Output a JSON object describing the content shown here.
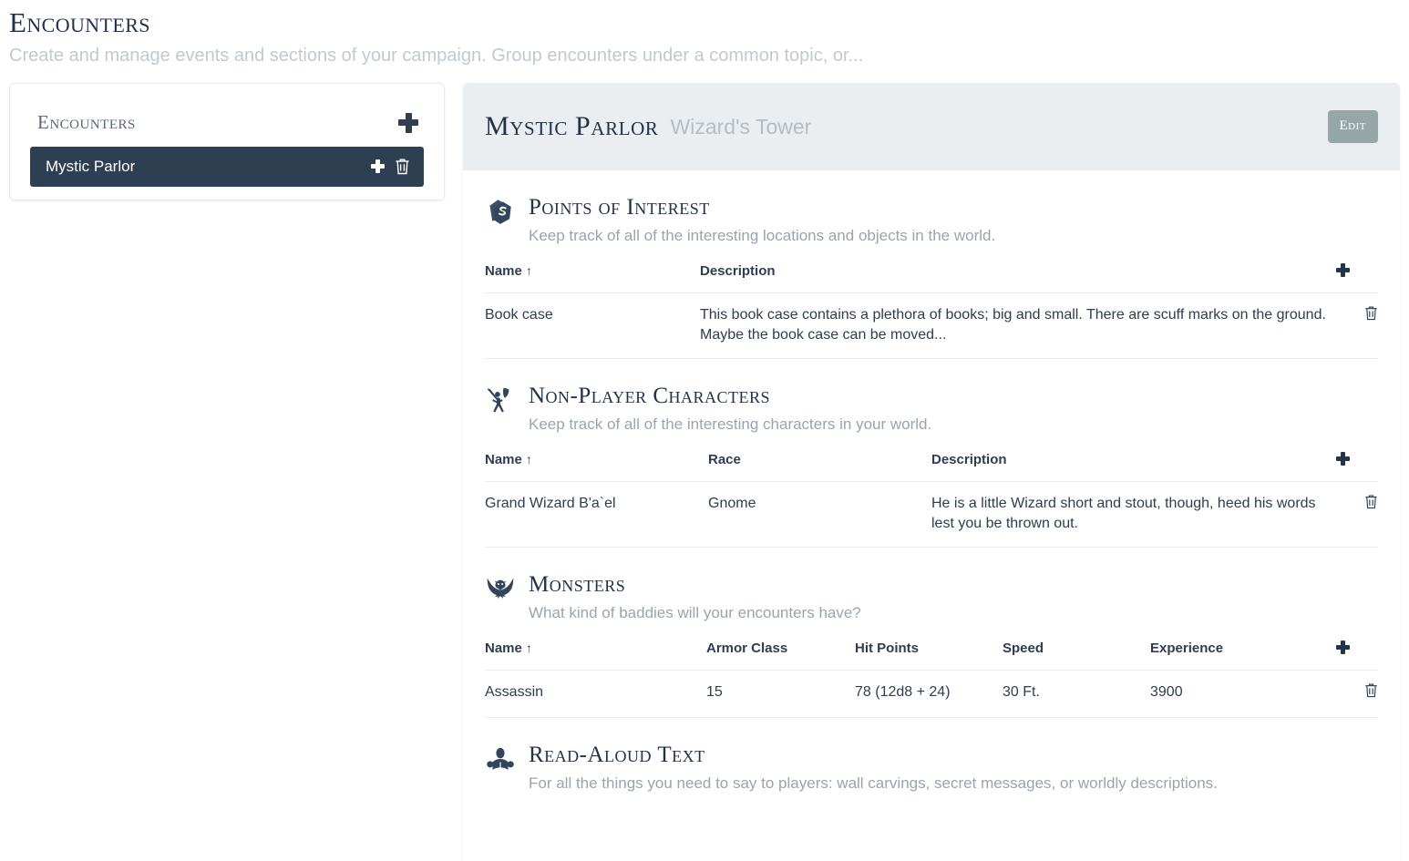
{
  "page": {
    "title": "Encounters",
    "subtitle": "Create and manage events and sections of your campaign. Group encounters under a common topic, or..."
  },
  "sidebar": {
    "header_title": "Encounters",
    "add_icon": "plus-icon",
    "items": [
      {
        "label": "Mystic Parlor",
        "selected": true,
        "add_icon": "plus-icon",
        "delete_icon": "trash-icon"
      }
    ]
  },
  "panel": {
    "title": "Mystic Parlor",
    "subtitle": "Wizard's Tower",
    "edit_label": "Edit"
  },
  "sections": [
    {
      "id": "points-of-interest",
      "icon": "card-stack-icon",
      "title": "Points of Interest",
      "description": "Keep track of all of the interesting locations and objects in the world.",
      "columns": [
        "Name",
        "Description"
      ],
      "sort_column": "Name",
      "sort_arrow": "↑",
      "add_icon": "plus-icon",
      "delete_icon": "trash-icon",
      "rows": [
        {
          "Name": "Book case",
          "Description": "This book case contains a plethora of books; big and small. There are scuff marks on the ground. Maybe the book case can be moved..."
        }
      ]
    },
    {
      "id": "non-player-characters",
      "icon": "warrior-icon",
      "title": "Non-Player Characters",
      "description": "Keep track of all of the interesting characters in your world.",
      "columns": [
        "Name",
        "Race",
        "Description"
      ],
      "sort_column": "Name",
      "sort_arrow": "↑",
      "add_icon": "plus-icon",
      "delete_icon": "trash-icon",
      "rows": [
        {
          "Name": "Grand Wizard B'a`el",
          "Race": "Gnome",
          "Description": "He is a little Wizard short and stout, though, heed his words lest you be thrown out."
        }
      ]
    },
    {
      "id": "monsters",
      "icon": "dragon-icon",
      "title": "Monsters",
      "description": "What kind of baddies will your encounters have?",
      "columns": [
        "Name",
        "Armor Class",
        "Hit Points",
        "Speed",
        "Experience"
      ],
      "sort_column": "Name",
      "sort_arrow": "↑",
      "add_icon": "plus-icon",
      "delete_icon": "trash-icon",
      "rows": [
        {
          "Name": "Assassin",
          "Armor Class": "15",
          "Hit Points": "78 (12d8 + 24)",
          "Speed": "30 Ft.",
          "Experience": "3900"
        }
      ]
    },
    {
      "id": "read-aloud-text",
      "icon": "reader-icon",
      "title": "Read-Aloud Text",
      "description": "For all the things you need to say to players: wall carvings, secret messages, or worldly descriptions.",
      "columns": [],
      "rows": []
    }
  ],
  "colors": {
    "accent_dark": "#2e3f52",
    "panel_header_bg": "#eaeef0",
    "edit_button_bg": "#97a6a6",
    "muted_text": "#9aa4ae",
    "title_text": "#22324a"
  }
}
